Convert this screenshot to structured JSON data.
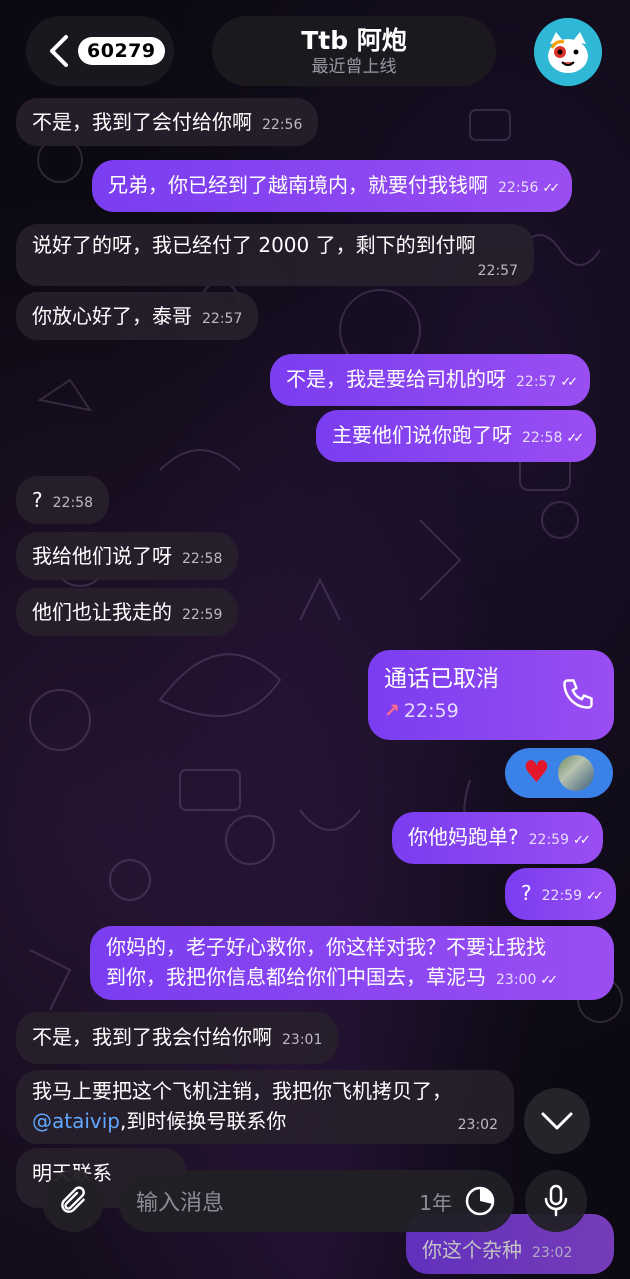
{
  "header": {
    "unread_count": "60279",
    "contact_name": "Ttb 阿炮",
    "status": "最近曾上线"
  },
  "messages": [
    {
      "text": "不是，我到了会付给你啊",
      "time": "22:56"
    },
    {
      "text": "兄弟，你已经到了越南境内，就要付我钱啊",
      "time": "22:56"
    },
    {
      "text": "说好了的呀，我已经付了 2000 了，剩下的到付啊",
      "time": "22:57"
    },
    {
      "text": "你放心好了，泰哥",
      "time": "22:57"
    },
    {
      "text": "不是，我是要给司机的呀",
      "time": "22:57"
    },
    {
      "text": "主要他们说你跑了呀",
      "time": "22:58"
    },
    {
      "text": "?",
      "time": "22:58"
    },
    {
      "text": "我给他们说了呀",
      "time": "22:58"
    },
    {
      "text": "他们也让我走的",
      "time": "22:59"
    },
    {
      "text": "你他妈跑单?",
      "time": "22:59"
    },
    {
      "text": "?",
      "time": "22:59"
    },
    {
      "line1": "你妈的，老子好心救你，你这样对我？不要让我找",
      "line2": "到你，我把你信息都给你们中国去，草泥马",
      "time": "23:00"
    },
    {
      "text": "不是，我到了我会付给你啊",
      "time": "23:01"
    },
    {
      "line1": "我马上要把这个飞机注销，我把你飞机拷贝了，",
      "mention": "@ataivip",
      "line2_rest": ",到时候换号联系你",
      "time": "23:02"
    },
    {
      "text": "明天联系"
    },
    {
      "text": "你这个杂种",
      "time": "23:02"
    }
  ],
  "call": {
    "title": "通话已取消",
    "time": "22:59"
  },
  "composer": {
    "placeholder": "输入消息",
    "timer": "1年"
  },
  "colors": {
    "outgoing_bubble": "#8b45f1",
    "incoming_bubble": "#28202c",
    "reaction_pill": "#3b82e8",
    "link": "#5fa8ff"
  }
}
